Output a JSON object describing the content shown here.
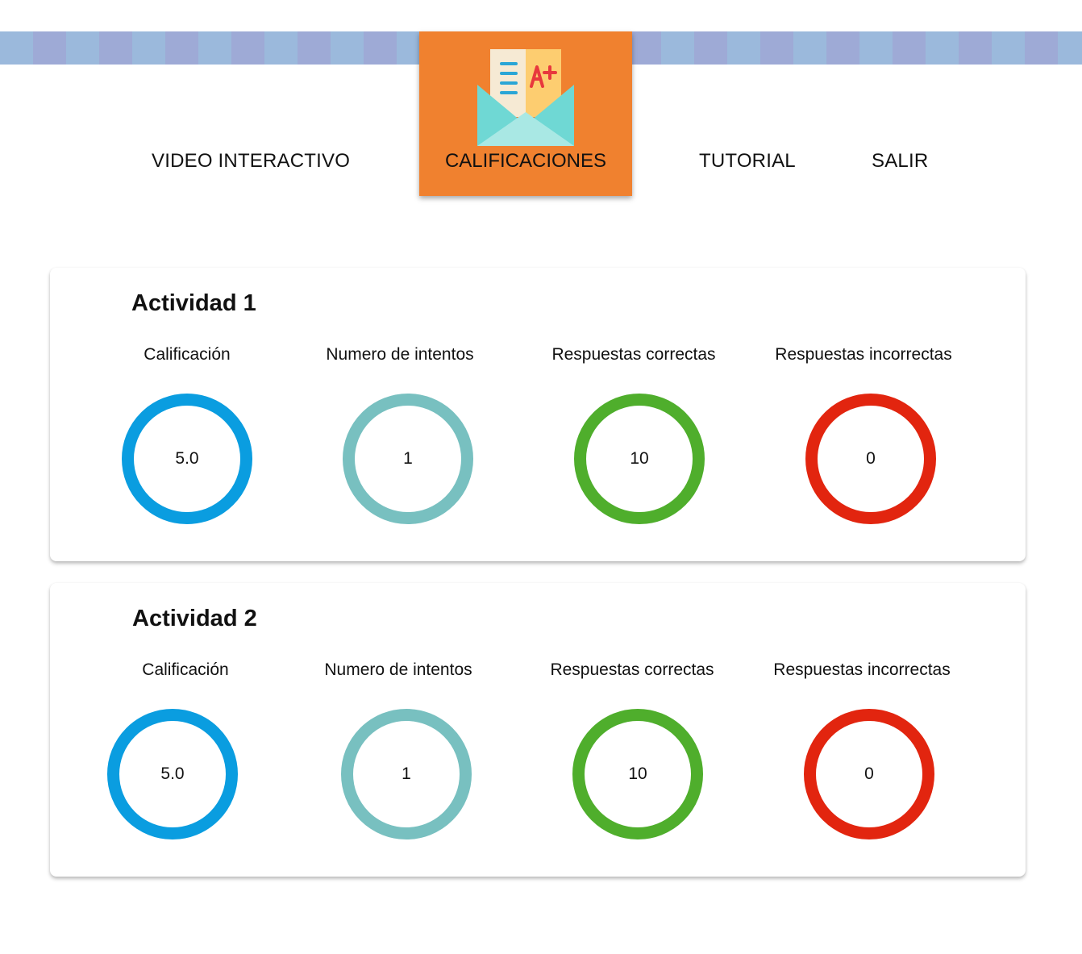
{
  "nav": {
    "items": [
      {
        "label": "VIDEO INTERACTIVO"
      },
      {
        "label": "CALIFICACIONES",
        "active": true,
        "icon": "graded-letter-envelope-icon"
      },
      {
        "label": "TUTORIAL"
      },
      {
        "label": "SALIR"
      }
    ]
  },
  "colors": {
    "band_a": "#9bb9dc",
    "band_b": "#9eaad6",
    "active_tab": "#f0812f",
    "calificacion": "#0a9de0",
    "intentos": "#78c0c0",
    "correctas": "#4fae2c",
    "incorrectas": "#e2250f"
  },
  "activities": [
    {
      "title": "Actividad 1",
      "stats": [
        {
          "label": "Calificación",
          "value": "5.0"
        },
        {
          "label": "Numero de intentos",
          "value": "1"
        },
        {
          "label": "Respuestas correctas",
          "value": "10"
        },
        {
          "label": "Respuestas incorrectas",
          "value": "0"
        }
      ]
    },
    {
      "title": "Actividad 2",
      "stats": [
        {
          "label": "Calificación",
          "value": "5.0"
        },
        {
          "label": "Numero de intentos",
          "value": "1"
        },
        {
          "label": "Respuestas correctas",
          "value": "10"
        },
        {
          "label": "Respuestas incorrectas",
          "value": "0"
        }
      ]
    }
  ]
}
